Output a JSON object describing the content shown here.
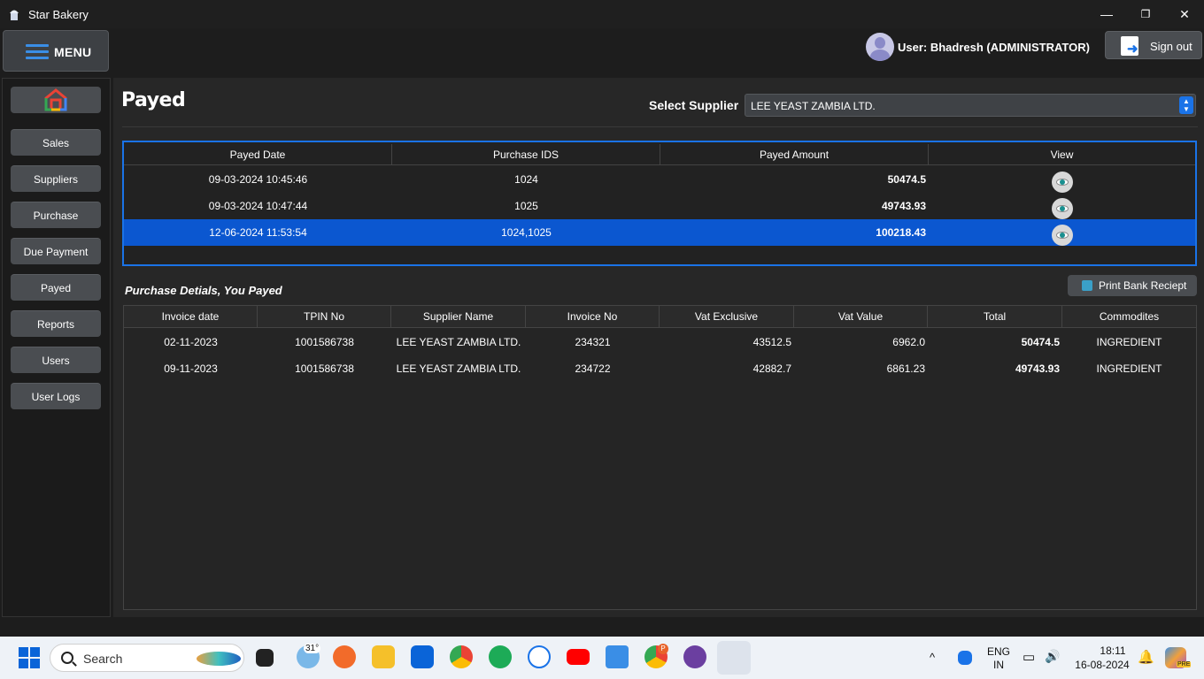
{
  "window": {
    "title": "Star Bakery",
    "min": "—",
    "max": "❐",
    "close": "✕"
  },
  "menu": {
    "label": "MENU"
  },
  "user": {
    "text": "User: Bhadresh  (ADMINISTRATOR)"
  },
  "signout": {
    "label": "Sign out"
  },
  "sidebar": {
    "items": [
      {
        "label": "Sales"
      },
      {
        "label": "Suppliers"
      },
      {
        "label": "Purchase"
      },
      {
        "label": "Due Payment"
      },
      {
        "label": "Payed"
      },
      {
        "label": "Reports"
      },
      {
        "label": "Users"
      },
      {
        "label": "User Logs"
      }
    ]
  },
  "page": {
    "title": "Payed"
  },
  "supplier": {
    "label": "Select Supplier",
    "value": "LEE YEAST ZAMBIA LTD."
  },
  "payments": {
    "headers": [
      "Payed Date",
      "Purchase IDS",
      "Payed Amount",
      "View"
    ],
    "rows": [
      {
        "date": "09-03-2024 10:45:46",
        "ids": "1024",
        "amount": "50474.5",
        "selected": false
      },
      {
        "date": "09-03-2024 10:47:44",
        "ids": "1025",
        "amount": "49743.93",
        "selected": false
      },
      {
        "date": "12-06-2024 11:53:54",
        "ids": "1024,1025",
        "amount": "100218.43",
        "selected": true
      }
    ]
  },
  "details": {
    "title": "Purchase Detials, You Payed",
    "print_label": "Print Bank Reciept",
    "headers": [
      "Invoice date",
      "TPIN No",
      "Supplier Name",
      "Invoice No",
      "Vat Exclusive",
      "Vat Value",
      "Total",
      "Commodites"
    ],
    "rows": [
      {
        "date": "02-11-2023",
        "tpin": "1001586738",
        "supplier": "LEE YEAST ZAMBIA LTD.",
        "invoice": "234321",
        "vat_excl": "43512.5",
        "vat": "6962.0",
        "total": "50474.5",
        "commodity": "INGREDIENT"
      },
      {
        "date": "09-11-2023",
        "tpin": "1001586738",
        "supplier": "LEE YEAST ZAMBIA LTD.",
        "invoice": "234722",
        "vat_excl": "42882.7",
        "vat": "6861.23",
        "total": "49743.93",
        "commodity": "INGREDIENT"
      }
    ]
  },
  "taskbar": {
    "search": "Search",
    "weather": "31°",
    "lang1": "ENG",
    "lang2": "IN",
    "time": "18:11",
    "date": "16-08-2024",
    "badge": "P",
    "copilot_badge": "PRE"
  },
  "colors": {
    "accent": "#1a73e8",
    "selected_row": "#0b57d0",
    "button": "#4a4d51"
  }
}
